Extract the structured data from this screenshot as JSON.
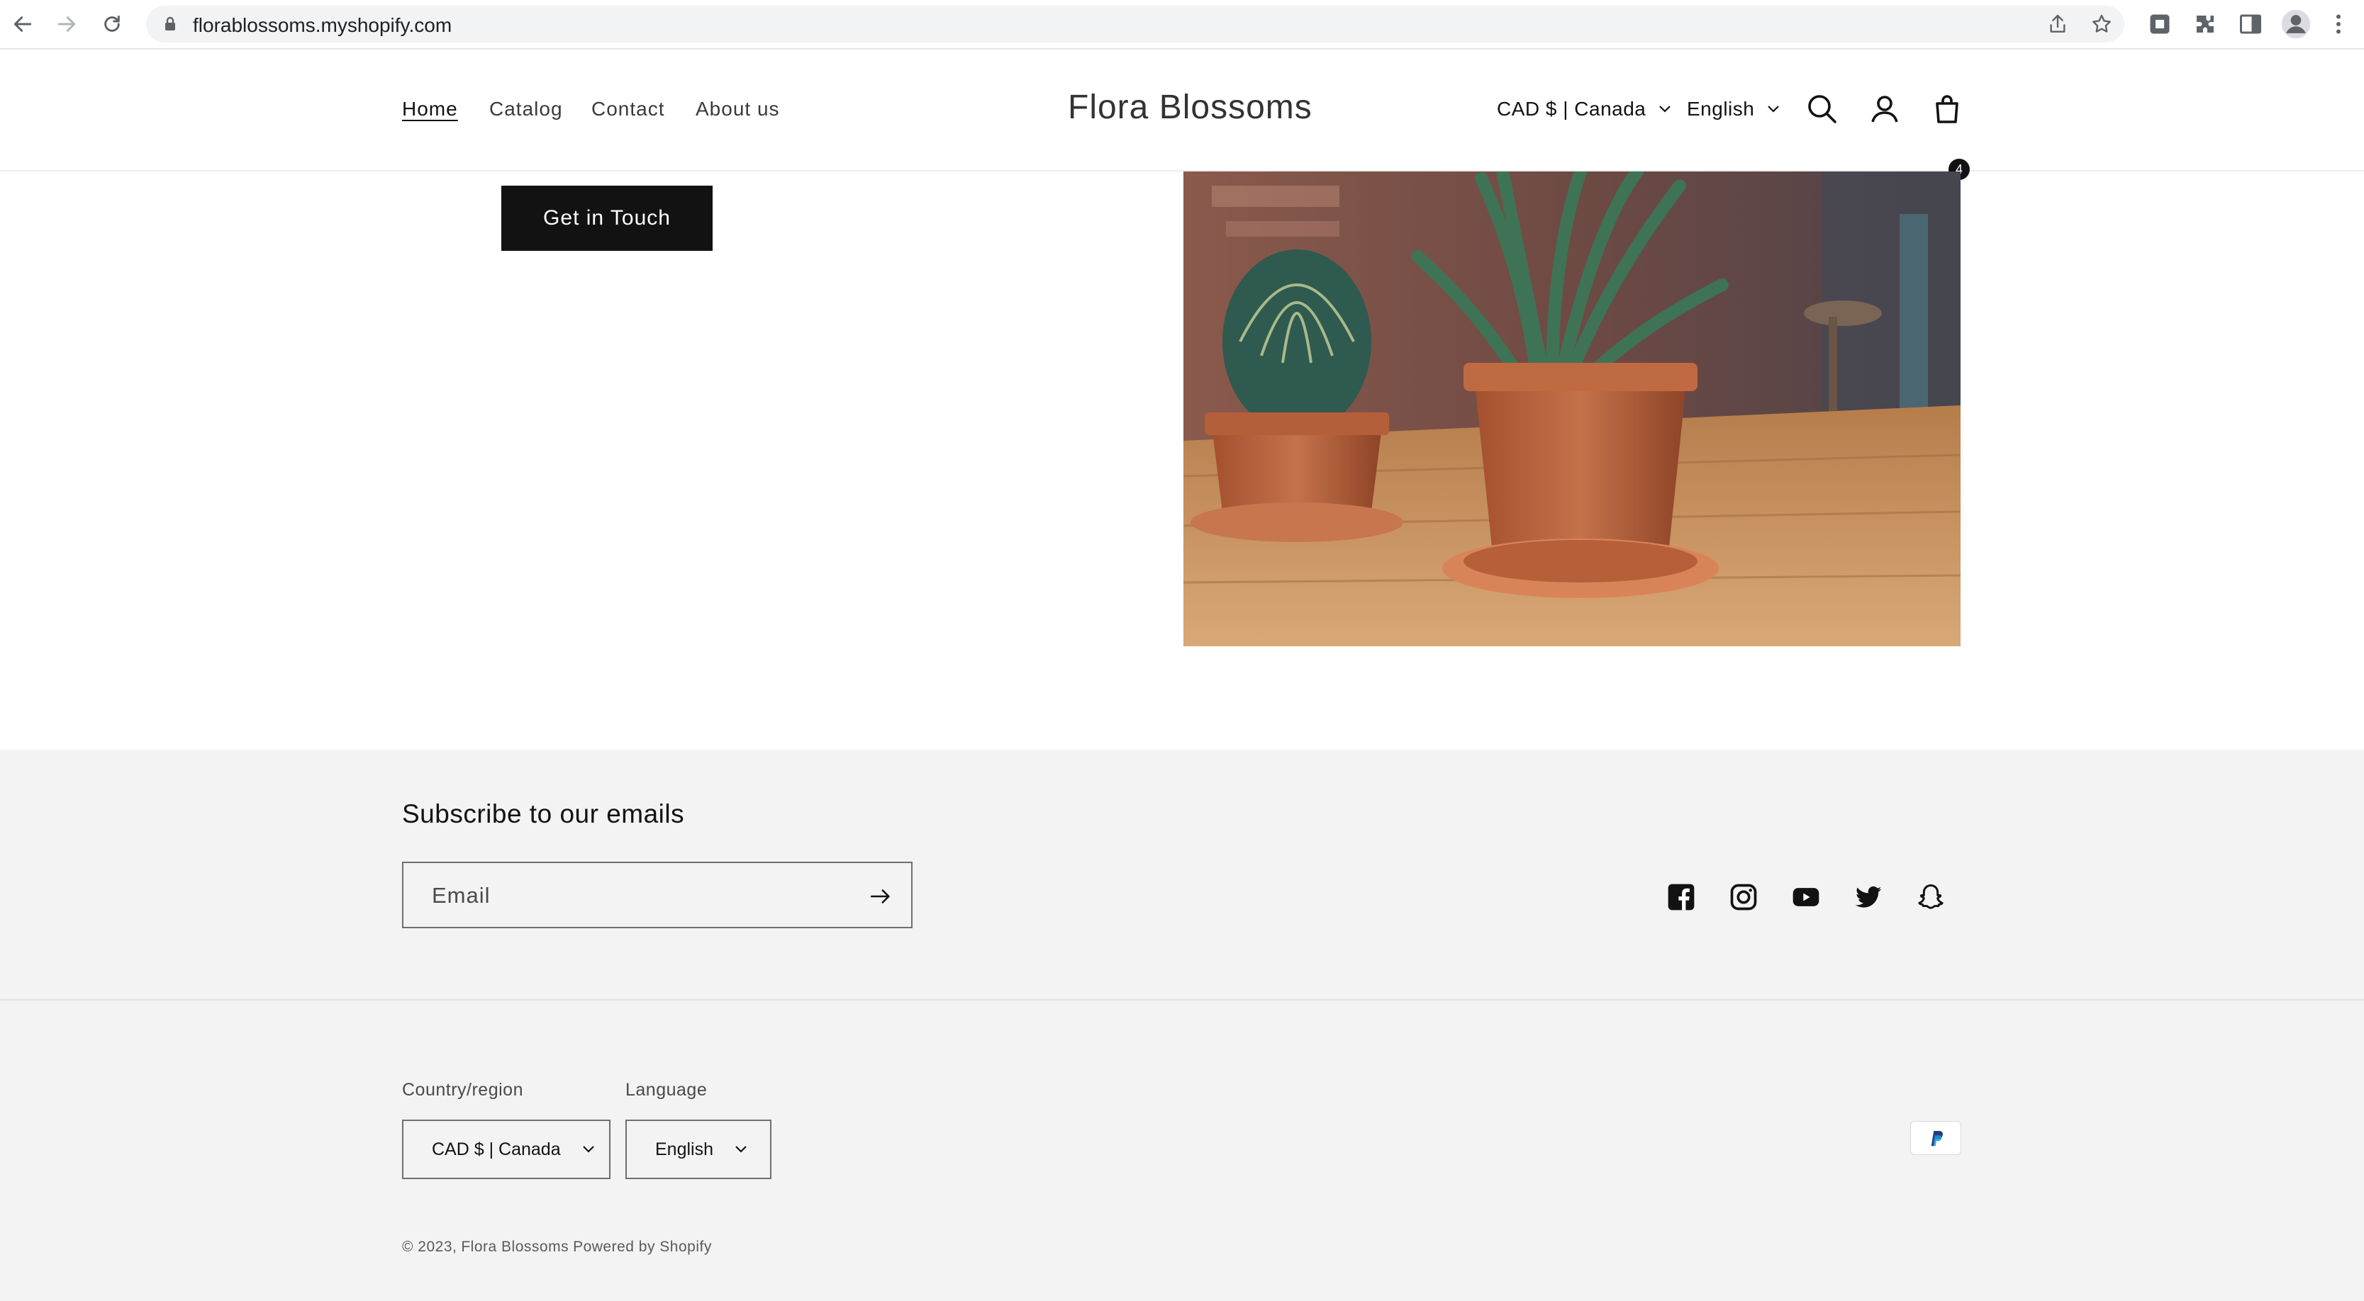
{
  "browser": {
    "url": "florablossoms.myshopify.com"
  },
  "header": {
    "nav": [
      "Home",
      "Catalog",
      "Contact",
      "About us"
    ],
    "brand": "Flora Blossoms",
    "currency": "CAD $ | Canada",
    "language": "English",
    "cart_count": "4"
  },
  "hero": {
    "cta_label": "Get in Touch"
  },
  "footer": {
    "subscribe_title": "Subscribe to our emails",
    "email_placeholder": "Email",
    "social_icons": [
      "facebook-icon",
      "instagram-icon",
      "youtube-icon",
      "twitter-icon",
      "snapchat-icon"
    ],
    "country_label": "Country/region",
    "country_value": "CAD $ | Canada",
    "language_label": "Language",
    "language_value": "English",
    "payment": "PayPal",
    "copyright": "© 2023,",
    "store_link": "Flora Blossoms",
    "powered_by": "Powered by Shopify"
  },
  "colors": {
    "button": "#121212",
    "footer_bg": "#f3f3f3",
    "accent_paypal": "#253b80"
  }
}
